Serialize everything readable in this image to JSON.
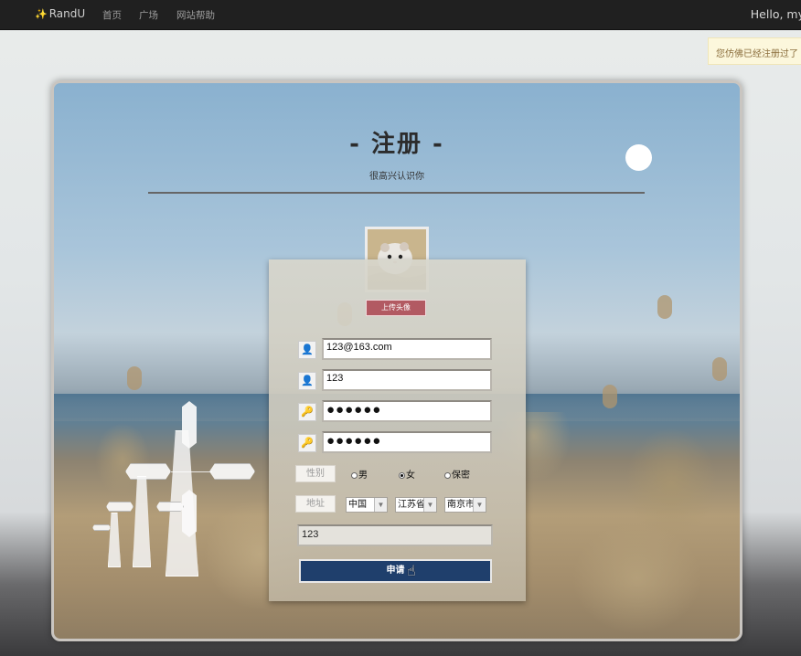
{
  "navbar": {
    "brand": "RandU",
    "brand_icon": "sparkle-icon",
    "links": [
      "首页",
      "广场",
      "网站帮助"
    ],
    "greeting": "Hello, my"
  },
  "toast": {
    "message": "您仿佛已经注册过了"
  },
  "page": {
    "title": "- 注册 -",
    "subtitle": "很高兴认识你"
  },
  "form": {
    "upload_label": "上传头像",
    "email_value": "123@163.com",
    "username_value": "123",
    "password_value": "●●●●●●",
    "password_confirm_value": "●●●●●●",
    "gender_label": "性别",
    "gender_options": [
      "男",
      "女",
      "保密"
    ],
    "gender_selected": "女",
    "address_label": "地址",
    "country": "中国",
    "province": "江苏省",
    "city": "南京市",
    "address_detail": "123",
    "submit_label": "申请"
  },
  "colors": {
    "navbar_bg": "#202020",
    "submit_bg": "#1f3f6c",
    "upload_bg": "#b25a62",
    "toast_bg": "#fcf7dc"
  }
}
